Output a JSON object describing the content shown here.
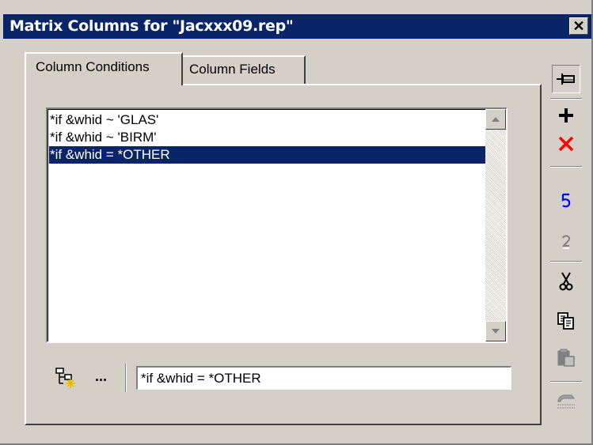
{
  "window": {
    "title": "Matrix Columns for \"Jacxxx09.rep\"",
    "close_glyph": "✕"
  },
  "tabs": [
    {
      "label": "Column Conditions",
      "active": true
    },
    {
      "label": "Column Fields",
      "active": false
    }
  ],
  "conditions": {
    "items": [
      {
        "text": "*if &whid ~ 'GLAS'",
        "selected": false
      },
      {
        "text": "*if &whid ~ 'BIRM'",
        "selected": false
      },
      {
        "text": "*if &whid = *OTHER",
        "selected": true
      }
    ]
  },
  "editor": {
    "ellipsis_label": "...",
    "value": "*if &whid = *OTHER"
  },
  "toolbar": {
    "icons": [
      "pin-icon",
      "add-icon",
      "delete-icon",
      "undo-icon",
      "redo-icon",
      "cut-icon",
      "copy-icon",
      "paste-icon",
      "find-replace-icon"
    ],
    "colors": {
      "add": "#000000",
      "delete": "#ff0000",
      "undo": "#0000ff",
      "disabled": "#808080"
    }
  },
  "colors": {
    "titlebar": "#0a246a",
    "face": "#d4d0c8",
    "selection": "#0a246a"
  }
}
